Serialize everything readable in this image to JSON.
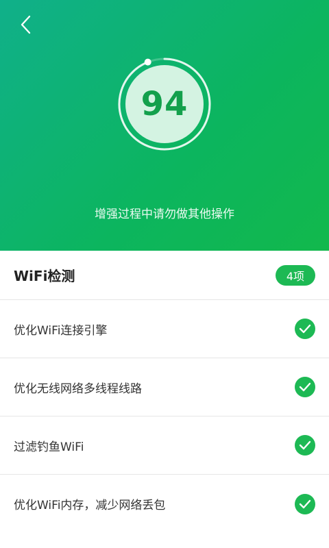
{
  "hero": {
    "score": "94",
    "progress": 0.94,
    "hint": "增强过程中请勿做其他操作",
    "back_icon": "chevron-left-icon"
  },
  "section": {
    "title": "WiFi检测",
    "count": "4项"
  },
  "items": [
    {
      "label": "优化WiFi连接引擎",
      "status": "done",
      "icon": "check-circle-icon"
    },
    {
      "label": "优化无线网络多线程线路",
      "status": "done",
      "icon": "check-circle-icon"
    },
    {
      "label": "过滤钓鱼WiFi",
      "status": "done",
      "icon": "check-circle-icon"
    },
    {
      "label": "优化WiFi内存，减少网络丢包",
      "status": "done",
      "icon": "check-circle-icon"
    }
  ],
  "colors": {
    "accent": "#1db954",
    "hero_start": "#10b08a",
    "hero_end": "#12b84c",
    "score_text": "#13a04c"
  }
}
